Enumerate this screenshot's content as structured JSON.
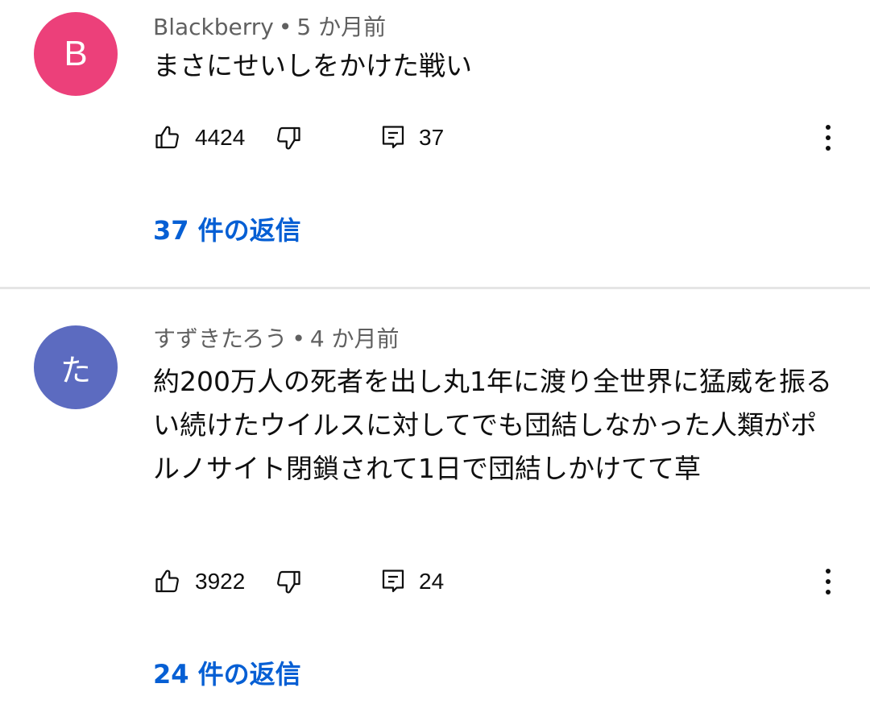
{
  "colors": {
    "avatar_b": "#ec407a",
    "avatar_ta": "#5c6bc0",
    "link_blue": "#065fd4",
    "meta_gray": "#606060",
    "divider": "#e5e5e5"
  },
  "comments": [
    {
      "avatar_letter": "B",
      "author": "Blackberry",
      "time": "5 か月前",
      "text": "まさにせいしをかけた戦い",
      "likes": "4424",
      "reply_count": "37",
      "replies_link": "37 件の返信",
      "icons": [
        "thumbs-up-icon",
        "thumbs-down-icon",
        "reply-icon",
        "more-vert-icon"
      ]
    },
    {
      "avatar_letter": "た",
      "author": "すずきたろう",
      "time": "4 か月前",
      "text": "約200万人の死者を出し丸1年に渡り全世界に猛威を振るい続けたウイルスに対してでも団結しなかった人類がポルノサイト閉鎖されて1日で団結しかけてて草",
      "likes": "3922",
      "reply_count": "24",
      "replies_link": "24 件の返信",
      "icons": [
        "thumbs-up-icon",
        "thumbs-down-icon",
        "reply-icon",
        "more-vert-icon"
      ]
    }
  ]
}
